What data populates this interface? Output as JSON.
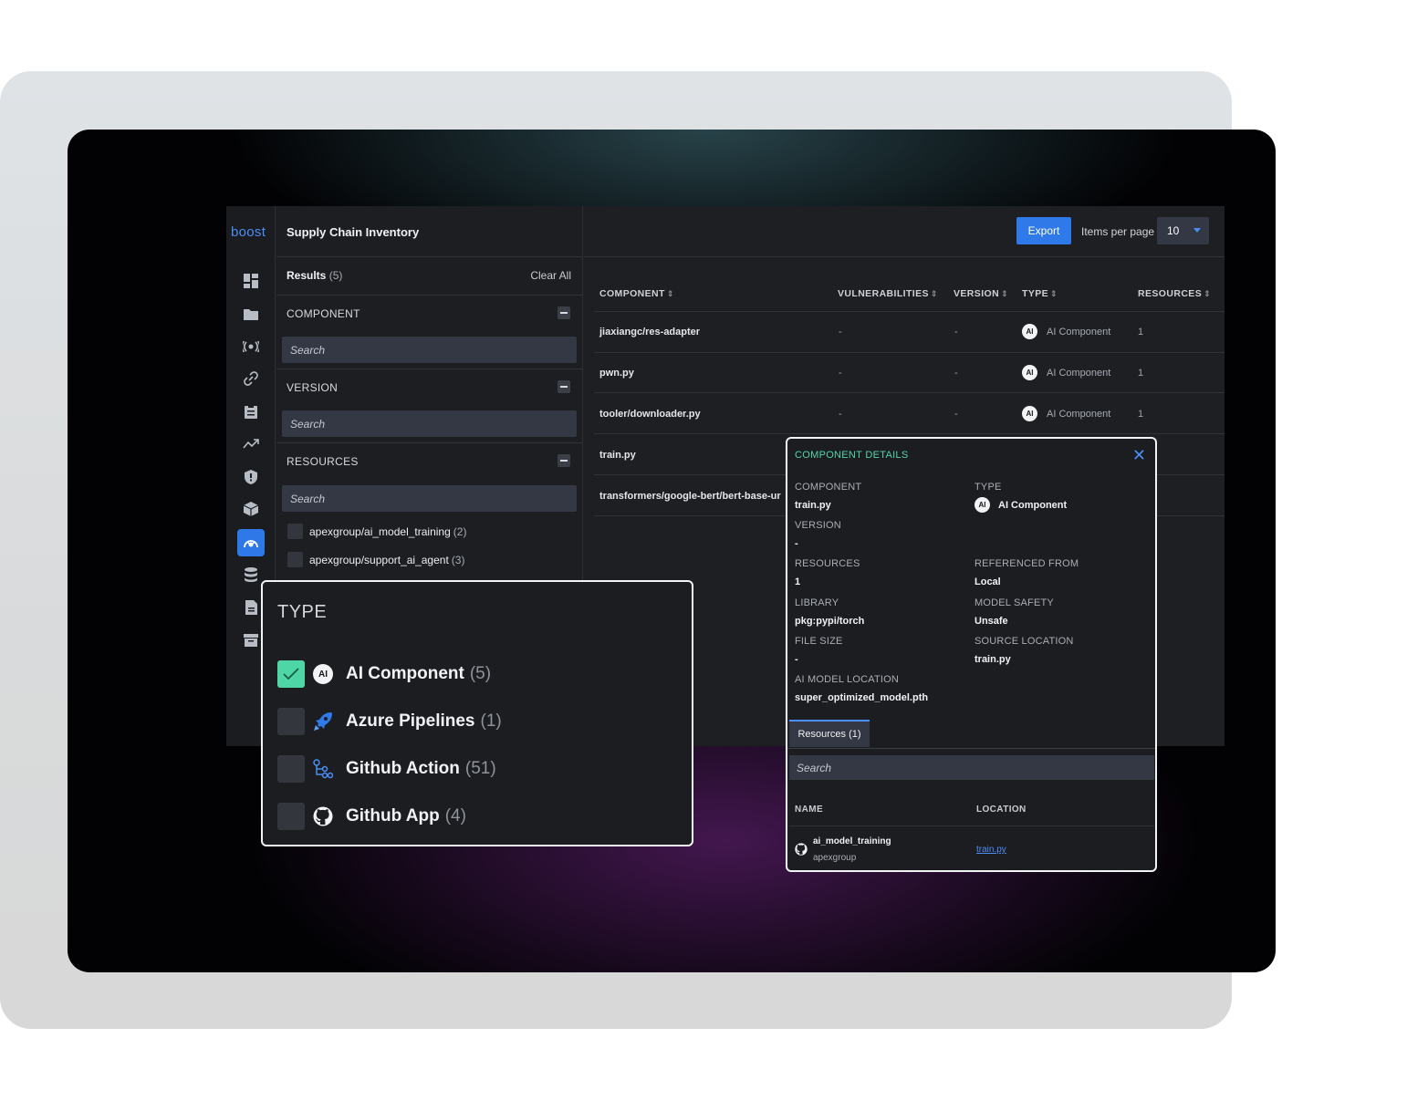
{
  "app": {
    "logo": "boost",
    "title": "Supply Chain Inventory"
  },
  "sidebar": {
    "icons": [
      "dashboard-icon",
      "folder-icon",
      "broadcast-icon",
      "link-icon",
      "clipboard-icon",
      "trend-icon",
      "shield-icon",
      "package-icon",
      "supply-chain-icon",
      "database-icon",
      "document-icon",
      "archive-icon"
    ],
    "active": "supply-chain-icon"
  },
  "filters": {
    "results_label": "Results",
    "results_count": "(5)",
    "clear_all": "Clear All",
    "sections": [
      {
        "label": "COMPONENT",
        "placeholder": "Search"
      },
      {
        "label": "VERSION",
        "placeholder": "Search"
      },
      {
        "label": "RESOURCES",
        "placeholder": "Search"
      }
    ],
    "resource_items": [
      {
        "label": "apexgroup/ai_model_training",
        "count": "(2)"
      },
      {
        "label": "apexgroup/support_ai_agent",
        "count": "(3)"
      }
    ]
  },
  "toolbar": {
    "export_label": "Export",
    "items_per_page_label": "Items per page",
    "items_per_page_value": "10"
  },
  "table": {
    "headers": [
      "COMPONENT",
      "VULNERABILITIES",
      "VERSION",
      "TYPE",
      "RESOURCES"
    ],
    "rows": [
      {
        "component": "jiaxiangc/res-adapter",
        "vulnerabilities": "-",
        "version": "-",
        "type": "AI Component",
        "resources": "1"
      },
      {
        "component": "pwn.py",
        "vulnerabilities": "-",
        "version": "-",
        "type": "AI Component",
        "resources": "1"
      },
      {
        "component": "tooler/downloader.py",
        "vulnerabilities": "-",
        "version": "-",
        "type": "AI Component",
        "resources": "1"
      },
      {
        "component": "train.py"
      },
      {
        "component": "transformers/google-bert/bert-base-ur"
      }
    ],
    "ai_badge": "AI"
  },
  "type_filter": {
    "title": "TYPE",
    "options": [
      {
        "label": "AI Component",
        "count": "(5)",
        "checked": true,
        "icon": "ai-component-icon"
      },
      {
        "label": "Azure Pipelines",
        "count": "(1)",
        "checked": false,
        "icon": "azure-pipelines-icon"
      },
      {
        "label": "Github Action",
        "count": "(51)",
        "checked": false,
        "icon": "github-action-icon"
      },
      {
        "label": "Github App",
        "count": "(4)",
        "checked": false,
        "icon": "github-icon"
      }
    ]
  },
  "details": {
    "title": "COMPONENT DETAILS",
    "component_label": "COMPONENT",
    "component_value": "train.py",
    "type_label": "TYPE",
    "type_value": "AI Component",
    "version_label": "VERSION",
    "version_value": "-",
    "resources_label": "RESOURCES",
    "resources_value": "1",
    "referenced_from_label": "REFERENCED FROM",
    "referenced_from_value": "Local",
    "library_label": "LIBRARY",
    "library_value": "pkg:pypi/torch",
    "model_safety_label": "MODEL SAFETY",
    "model_safety_value": "Unsafe",
    "file_size_label": "FILE SIZE",
    "file_size_value": "-",
    "source_location_label": "SOURCE LOCATION",
    "source_location_value": "train.py",
    "ai_model_location_label": "AI MODEL LOCATION",
    "ai_model_location_value": "super_optimized_model.pth",
    "tab_label": "Resources (1)",
    "search_placeholder": "Search",
    "col_name": "NAME",
    "col_location": "LOCATION",
    "resource_name": "ai_model_training",
    "resource_org": "apexgroup",
    "resource_location": "train.py"
  },
  "colors": {
    "accent_blue": "#2f7ae8",
    "accent_green": "#4fd6a6",
    "panel_bg": "#1c1d21"
  }
}
